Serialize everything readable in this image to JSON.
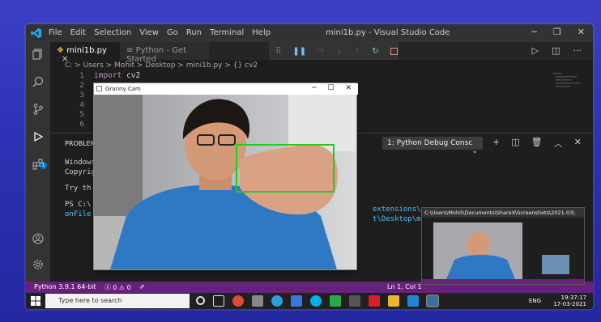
{
  "window": {
    "title": "mini1b.py - Visual Studio Code"
  },
  "menu": [
    "File",
    "Edit",
    "Selection",
    "View",
    "Go",
    "Run",
    "Terminal",
    "Help"
  ],
  "tabs": [
    {
      "label": "mini1b.py",
      "active": true
    },
    {
      "label": "Python - Get Started",
      "active": false
    }
  ],
  "breadcrumb": "C: > Users > Mohit > Desktop > mini1b.py > {} cv2",
  "code": {
    "line_numbers": [
      "1",
      "2",
      "3",
      "4",
      "5",
      "6"
    ],
    "line1_keyword": "import",
    "line1_module": "cv2"
  },
  "activity_badge": "1",
  "panel": {
    "tab_label": "PROBLEMS",
    "console_select": "1: Python Debug Consc",
    "lines": [
      "Windows",
      "Copyright",
      "",
      "Try th",
      "",
      "PS C:\\",
      "onFile"
    ],
    "right_lines": [
      "extensions\\ms-p",
      "t\\Desktop\\mini1"
    ]
  },
  "statusbar": {
    "python": "Python 3.9.1 64-bit",
    "errors": "0",
    "warnings": "0",
    "position": "Ln 1, Col 1"
  },
  "taskbar": {
    "search_placeholder": "Type here to search",
    "lang": "ENG",
    "time": "19:37:17",
    "date": "17-03-2021"
  },
  "cam_window": {
    "title": "Granny Cam"
  },
  "preview": {
    "path": "C:\\Users\\Mohit\\Documents\\ShareX\\Screenshots\\2021-03\\"
  },
  "colors": {
    "statusbar": "#68217a",
    "detection_box": "#22cc22",
    "accent": "#007acc"
  }
}
